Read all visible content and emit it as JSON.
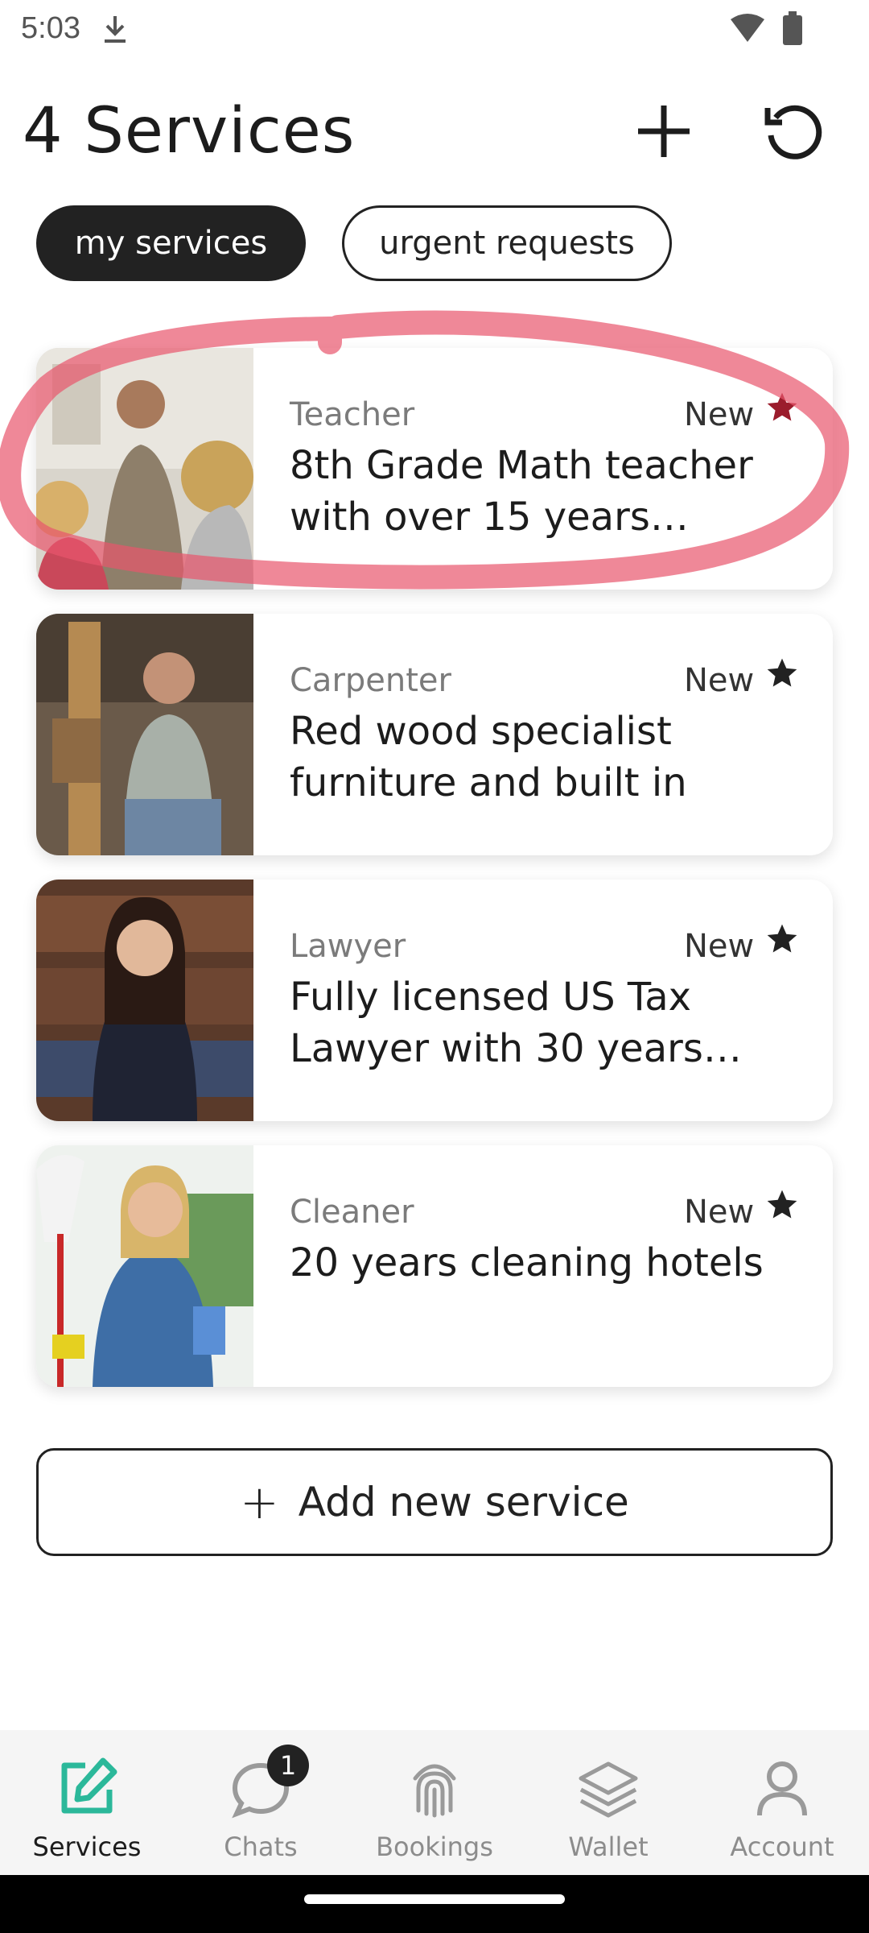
{
  "status_bar": {
    "time": "5:03"
  },
  "header": {
    "title": "4 Services"
  },
  "filters": [
    {
      "label": "my services",
      "active": true
    },
    {
      "label": "urgent requests",
      "active": false
    }
  ],
  "services": [
    {
      "category": "Teacher",
      "badge": "New",
      "description": "8th Grade Math teacher with over 15 years experience",
      "star_color": "#9b1c2c"
    },
    {
      "category": "Carpenter",
      "badge": "New",
      "description": "Red wood specialist furniture and built in",
      "star_color": "#222222"
    },
    {
      "category": "Lawyer",
      "badge": "New",
      "description": "Fully licensed US Tax Lawyer with 30 years experience",
      "star_color": "#222222"
    },
    {
      "category": "Cleaner",
      "badge": "New",
      "description": "20 years cleaning hotels",
      "star_color": "#222222"
    }
  ],
  "add_service": {
    "label": "Add new service"
  },
  "bottom_nav": [
    {
      "label": "Services",
      "icon": "edit-icon",
      "active": true
    },
    {
      "label": "Chats",
      "icon": "chat-icon",
      "badge": "1"
    },
    {
      "label": "Bookings",
      "icon": "fingerprint-icon"
    },
    {
      "label": "Wallet",
      "icon": "layers-icon"
    },
    {
      "label": "Account",
      "icon": "person-icon"
    }
  ],
  "colors": {
    "accent": "#2bb89a",
    "annotation": "#e8556c",
    "dark": "#222222"
  }
}
